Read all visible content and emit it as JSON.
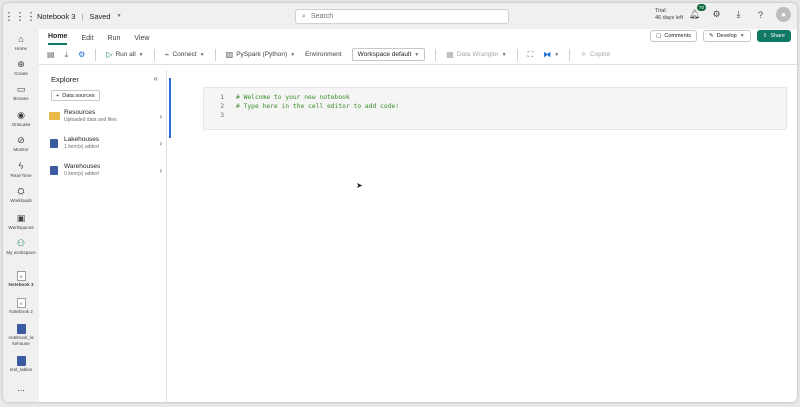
{
  "topbar": {
    "notebook_title": "Notebook 3",
    "sep": "|",
    "save_status": "Saved",
    "search_placeholder": "Search",
    "trial_line1": "Trial:",
    "trial_line2": "46 days left",
    "notification_count": "70"
  },
  "rail": {
    "items": [
      {
        "label": "Home"
      },
      {
        "label": "Create"
      },
      {
        "label": "Browse"
      },
      {
        "label": "OneLake"
      },
      {
        "label": "Monitor"
      },
      {
        "label": "Real-Time"
      },
      {
        "label": "Workloads"
      },
      {
        "label": "Workspaces"
      },
      {
        "label": "My workspace"
      },
      {
        "label": "Notebook 3"
      },
      {
        "label": "Notebook 2"
      },
      {
        "label": "notebook_la kehouse"
      },
      {
        "label": "test_tables"
      }
    ],
    "more": "..."
  },
  "menu": {
    "tabs": [
      "Home",
      "Edit",
      "Run",
      "View"
    ]
  },
  "toolbar": {
    "run_all": "Run all",
    "connect": "Connect",
    "language": "PySpark (Python)",
    "environment": "Environment",
    "workspace": "Workspace default",
    "data_wrangler": "Data Wrangler",
    "copilot": "Copilot"
  },
  "actions": {
    "comments": "Comments",
    "develop": "Develop",
    "share": "Share"
  },
  "explorer": {
    "title": "Explorer",
    "data_sources_btn": "Data sources",
    "items": [
      {
        "name": "Resources",
        "sub": "Uploaded data and files"
      },
      {
        "name": "Lakehouses",
        "sub": "1 item(s) added"
      },
      {
        "name": "Warehouses",
        "sub": "0 item(s) added"
      }
    ]
  },
  "cell": {
    "lines": [
      {
        "num": "1",
        "code": "# Welcome to your new notebook"
      },
      {
        "num": "2",
        "code": "# Type here in the cell editor to add code!"
      },
      {
        "num": "3",
        "code": ""
      }
    ]
  }
}
